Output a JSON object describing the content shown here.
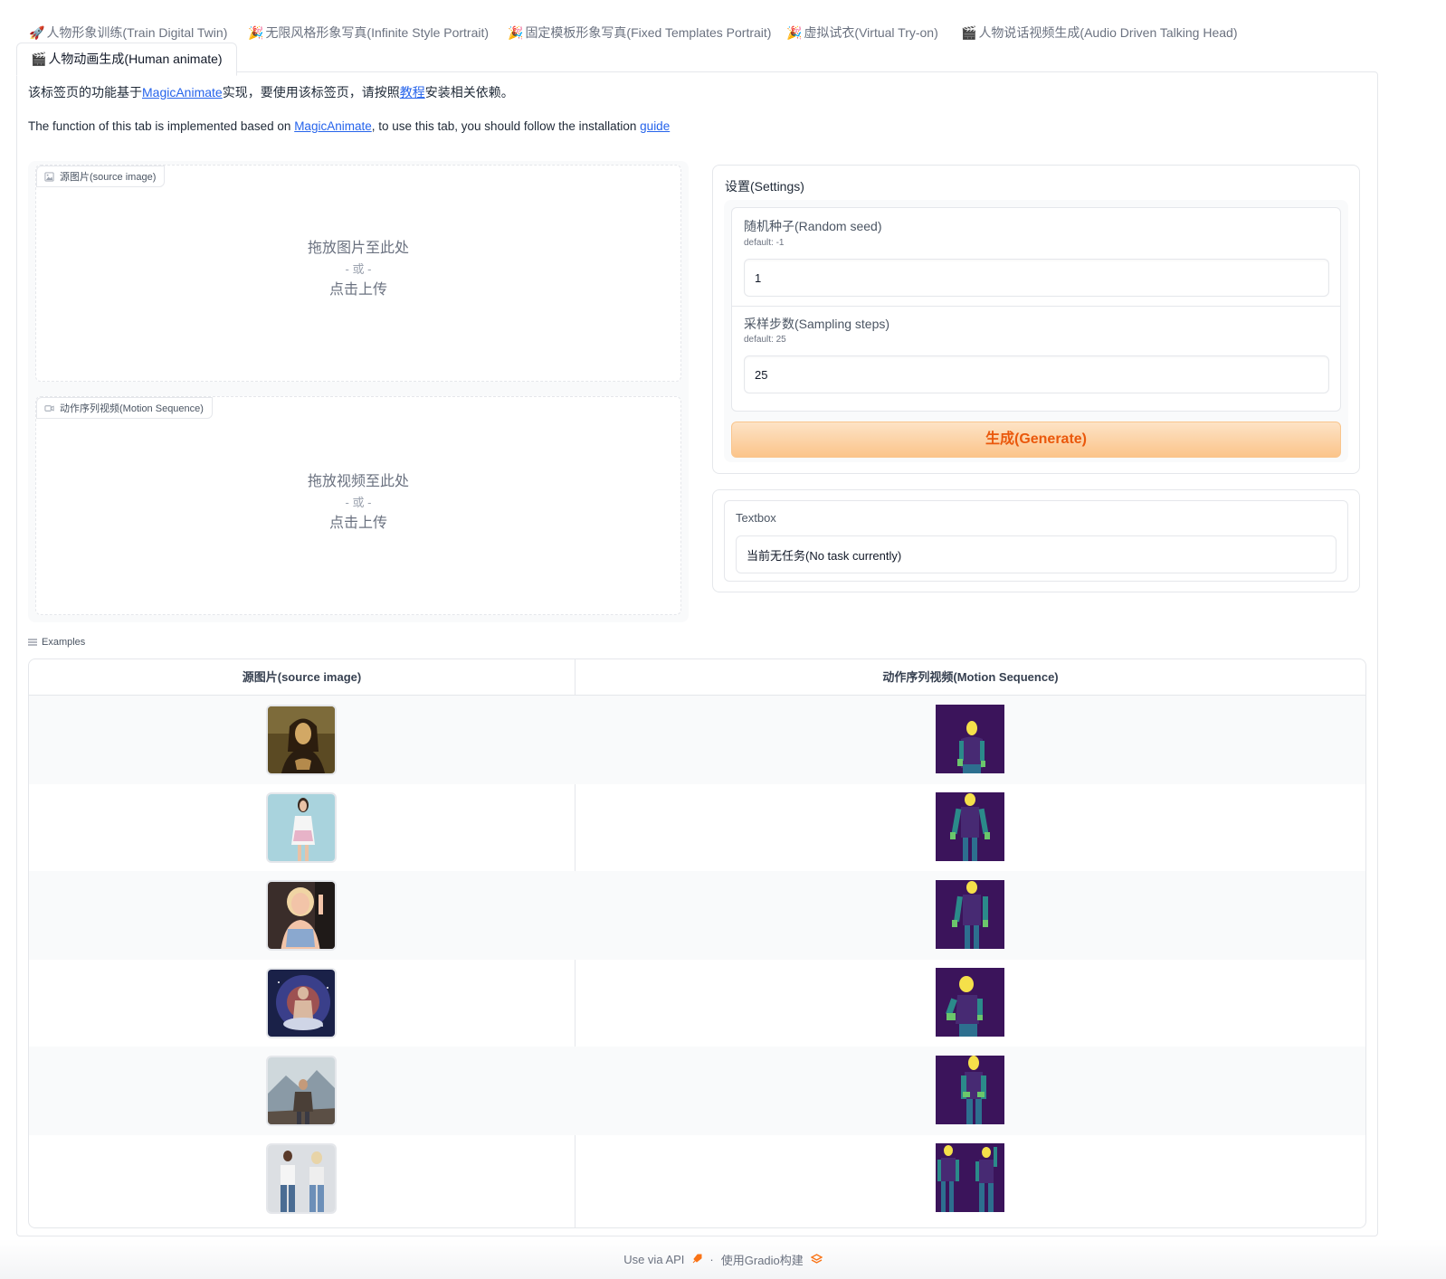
{
  "tabs": [
    {
      "emoji": "🚀",
      "label": "人物形象训练(Train Digital Twin)"
    },
    {
      "emoji": "🎉",
      "label": "无限风格形象写真(Infinite Style Portrait)"
    },
    {
      "emoji": "🎉",
      "label": "固定模板形象写真(Fixed Templates Portrait)"
    },
    {
      "emoji": "🎉",
      "label": "虚拟试衣(Virtual Try-on)"
    },
    {
      "emoji": "🎬",
      "label": "人物说话视频生成(Audio Driven Talking Head)"
    },
    {
      "emoji": "🎬",
      "label": "人物动画生成(Human animate)"
    }
  ],
  "description": {
    "zh_prefix": "该标签页的功能基于",
    "zh_link1": "MagicAnimate",
    "zh_middle": "实现，要使用该标签页，请按照",
    "zh_link2": "教程",
    "zh_suffix": "安装相关依赖。",
    "en_prefix": "The function of this tab is implemented based on ",
    "en_link1": "MagicAnimate",
    "en_middle": ", to use this tab, you should follow the installation ",
    "en_link2": "guide"
  },
  "source_image": {
    "label": "源图片(source image)",
    "drop_line1": "拖放图片至此处",
    "drop_line2": "- 或 -",
    "drop_line3": "点击上传"
  },
  "motion_sequence": {
    "label": "动作序列视频(Motion Sequence)",
    "drop_line1": "拖放视频至此处",
    "drop_line2": "- 或 -",
    "drop_line3": "点击上传"
  },
  "settings": {
    "title": "设置(Settings)",
    "seed_label": "随机种子(Random seed)",
    "seed_default": "default: -1",
    "seed_value": "1",
    "steps_label": "采样步数(Sampling steps)",
    "steps_default": "default: 25",
    "steps_value": "25",
    "generate_label": "生成(Generate)"
  },
  "textbox": {
    "label": "Textbox",
    "value": "当前无任务(No task currently)"
  },
  "examples": {
    "title": "Examples",
    "col1": "源图片(source image)",
    "col2": "动作序列视频(Motion Sequence)",
    "rows": 6
  },
  "footer": {
    "api": "Use via API",
    "sep": "·",
    "built": "使用Gradio构建"
  },
  "colors": {
    "accent": "#ea580c",
    "link": "#2563eb",
    "pose_bg": "#3b145b"
  }
}
